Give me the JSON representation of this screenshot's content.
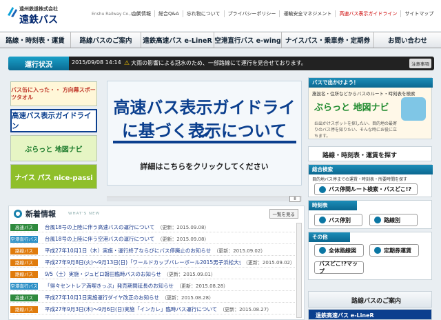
{
  "header": {
    "company": "遠州鉄道株式会社",
    "brand": "遠鉄バス",
    "brand_en": "Enshu Railway Co.,Ltd.",
    "util_nav": [
      "企業情報",
      "総合Q&A",
      "忘れ物について",
      "プライバシーポリシー",
      "運輸安全マネジメント",
      "高速バス表示ガイドライン",
      "サイトマップ"
    ]
  },
  "global_nav": [
    "路線・時刻表・運賃",
    "路線バスのご案内",
    "遠鉄高速バス e-LineR",
    "空港直行バス e-wing",
    "ナイスパス・乗車券・定期券",
    "お問い合わせ"
  ],
  "status": {
    "label": "運行状況",
    "datetime": "2015/09/08 14:14",
    "message": "大雨の影響による冠水のため、一部路線にて運行を見合せております。",
    "button": "注意事項"
  },
  "left_banners": [
    "バス缶に入った・・ 方向幕スポーツタオル",
    "高速バス表示ガイドライン",
    "ぶらっと 地図ナビ",
    "ナイス パス nice-passi"
  ],
  "hero": {
    "line1": "高速バス表示ガイドライン",
    "line2": "に基づく表示について",
    "sub": "詳細はこちらをクリックしてください"
  },
  "news": {
    "title": "新着情報",
    "subtitle": "WHAT'S NEW",
    "list_button": "一覧を見る",
    "items": [
      {
        "tag": "高速バス",
        "color": "#2f8a3e",
        "text": "台風18号の上陸に伴う高速バスの運行について",
        "date": "（更新：2015.09.08）"
      },
      {
        "tag": "空港直行バス",
        "color": "#2a8fc6",
        "text": "台風18号の上陸に伴う空港バスの運行について",
        "date": "（更新：2015.09.08）"
      },
      {
        "tag": "路線バス",
        "color": "#e07b0c",
        "text": "平成27年10月1日（木）実施・運行終了ならびにバス停廃止のお知らせ",
        "date": "（更新：2015.09.02）"
      },
      {
        "tag": "路線バス",
        "color": "#e07b0c",
        "text": "平成27年9月8日(火)～9月13日(日)「ワールドカップバレーボール2015男子浜松大会」に行かれる方へ",
        "date": "（更新：2015.09.02）"
      },
      {
        "tag": "路線バス",
        "color": "#e07b0c",
        "text": "9/5（土）実施・ジュビロ磐田臨時バスのお知らせ",
        "date": "（更新：2015.09.01）"
      },
      {
        "tag": "空港直行バス",
        "color": "#2a8fc6",
        "text": "「得々セントレア満喫きっぷ」発売期間延長のお知らせ",
        "date": "（更新：2015.08.28）"
      },
      {
        "tag": "高速バス",
        "color": "#2f8a3e",
        "text": "平成27年10月1日実施運行ダイヤ改正のお知らせ",
        "date": "（更新：2015.08.28）"
      },
      {
        "tag": "路線バス",
        "color": "#e07b0c",
        "text": "平成27年9月3日(木)～9月6日(日)実施「インカレ」臨時バス運行について",
        "date": "（更新：2015.08.27）"
      }
    ]
  },
  "right": {
    "promo_head": "バスで出かけよう！",
    "promo_text": "施設名・住所などからバスのルート・時刻表を検索",
    "promo_title": "ぶらっと 地図ナビ",
    "promo_note": "お出かけスポットを探したい、目的地の最寄りのバス停を知りたい、そんな時にお役に立ちます。",
    "search_title": "路線・時刻表・運賃を探す",
    "general_search": "総合検索",
    "general_desc": "目的地バス停までの運賃・時刻表・所要時間を探す",
    "btn_route": "バス停間ルート検索・バスどこ!?",
    "timetable": "時刻表",
    "btn_stop": "バス停別",
    "btn_line": "路線別",
    "other": "その他",
    "btn_map": "全体路線図",
    "btn_commuter": "定期券運賃",
    "btn_where": "バスどこ!?マップ",
    "route_bus": "路線バスのご案内",
    "eliner": "遠鉄高速バス e-LineR"
  },
  "colors": {
    "accent": "#0b6790",
    "nav_text": "#123"
  }
}
